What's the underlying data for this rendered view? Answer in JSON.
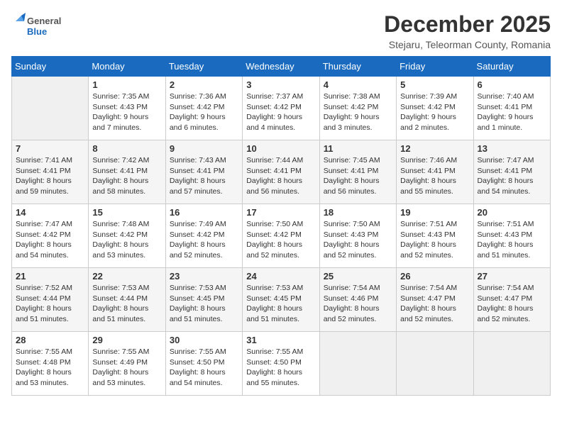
{
  "logo": {
    "general": "General",
    "blue": "Blue"
  },
  "title": {
    "month_year": "December 2025",
    "location": "Stejaru, Teleorman County, Romania"
  },
  "headers": [
    "Sunday",
    "Monday",
    "Tuesday",
    "Wednesday",
    "Thursday",
    "Friday",
    "Saturday"
  ],
  "weeks": [
    [
      {
        "day": "",
        "empty": true
      },
      {
        "day": "1",
        "sunrise": "Sunrise: 7:35 AM",
        "sunset": "Sunset: 4:43 PM",
        "daylight": "Daylight: 9 hours and 7 minutes."
      },
      {
        "day": "2",
        "sunrise": "Sunrise: 7:36 AM",
        "sunset": "Sunset: 4:42 PM",
        "daylight": "Daylight: 9 hours and 6 minutes."
      },
      {
        "day": "3",
        "sunrise": "Sunrise: 7:37 AM",
        "sunset": "Sunset: 4:42 PM",
        "daylight": "Daylight: 9 hours and 4 minutes."
      },
      {
        "day": "4",
        "sunrise": "Sunrise: 7:38 AM",
        "sunset": "Sunset: 4:42 PM",
        "daylight": "Daylight: 9 hours and 3 minutes."
      },
      {
        "day": "5",
        "sunrise": "Sunrise: 7:39 AM",
        "sunset": "Sunset: 4:42 PM",
        "daylight": "Daylight: 9 hours and 2 minutes."
      },
      {
        "day": "6",
        "sunrise": "Sunrise: 7:40 AM",
        "sunset": "Sunset: 4:41 PM",
        "daylight": "Daylight: 9 hours and 1 minute."
      }
    ],
    [
      {
        "day": "7",
        "sunrise": "Sunrise: 7:41 AM",
        "sunset": "Sunset: 4:41 PM",
        "daylight": "Daylight: 8 hours and 59 minutes."
      },
      {
        "day": "8",
        "sunrise": "Sunrise: 7:42 AM",
        "sunset": "Sunset: 4:41 PM",
        "daylight": "Daylight: 8 hours and 58 minutes."
      },
      {
        "day": "9",
        "sunrise": "Sunrise: 7:43 AM",
        "sunset": "Sunset: 4:41 PM",
        "daylight": "Daylight: 8 hours and 57 minutes."
      },
      {
        "day": "10",
        "sunrise": "Sunrise: 7:44 AM",
        "sunset": "Sunset: 4:41 PM",
        "daylight": "Daylight: 8 hours and 56 minutes."
      },
      {
        "day": "11",
        "sunrise": "Sunrise: 7:45 AM",
        "sunset": "Sunset: 4:41 PM",
        "daylight": "Daylight: 8 hours and 56 minutes."
      },
      {
        "day": "12",
        "sunrise": "Sunrise: 7:46 AM",
        "sunset": "Sunset: 4:41 PM",
        "daylight": "Daylight: 8 hours and 55 minutes."
      },
      {
        "day": "13",
        "sunrise": "Sunrise: 7:47 AM",
        "sunset": "Sunset: 4:41 PM",
        "daylight": "Daylight: 8 hours and 54 minutes."
      }
    ],
    [
      {
        "day": "14",
        "sunrise": "Sunrise: 7:47 AM",
        "sunset": "Sunset: 4:42 PM",
        "daylight": "Daylight: 8 hours and 54 minutes."
      },
      {
        "day": "15",
        "sunrise": "Sunrise: 7:48 AM",
        "sunset": "Sunset: 4:42 PM",
        "daylight": "Daylight: 8 hours and 53 minutes."
      },
      {
        "day": "16",
        "sunrise": "Sunrise: 7:49 AM",
        "sunset": "Sunset: 4:42 PM",
        "daylight": "Daylight: 8 hours and 52 minutes."
      },
      {
        "day": "17",
        "sunrise": "Sunrise: 7:50 AM",
        "sunset": "Sunset: 4:42 PM",
        "daylight": "Daylight: 8 hours and 52 minutes."
      },
      {
        "day": "18",
        "sunrise": "Sunrise: 7:50 AM",
        "sunset": "Sunset: 4:43 PM",
        "daylight": "Daylight: 8 hours and 52 minutes."
      },
      {
        "day": "19",
        "sunrise": "Sunrise: 7:51 AM",
        "sunset": "Sunset: 4:43 PM",
        "daylight": "Daylight: 8 hours and 52 minutes."
      },
      {
        "day": "20",
        "sunrise": "Sunrise: 7:51 AM",
        "sunset": "Sunset: 4:43 PM",
        "daylight": "Daylight: 8 hours and 51 minutes."
      }
    ],
    [
      {
        "day": "21",
        "sunrise": "Sunrise: 7:52 AM",
        "sunset": "Sunset: 4:44 PM",
        "daylight": "Daylight: 8 hours and 51 minutes."
      },
      {
        "day": "22",
        "sunrise": "Sunrise: 7:53 AM",
        "sunset": "Sunset: 4:44 PM",
        "daylight": "Daylight: 8 hours and 51 minutes."
      },
      {
        "day": "23",
        "sunrise": "Sunrise: 7:53 AM",
        "sunset": "Sunset: 4:45 PM",
        "daylight": "Daylight: 8 hours and 51 minutes."
      },
      {
        "day": "24",
        "sunrise": "Sunrise: 7:53 AM",
        "sunset": "Sunset: 4:45 PM",
        "daylight": "Daylight: 8 hours and 51 minutes."
      },
      {
        "day": "25",
        "sunrise": "Sunrise: 7:54 AM",
        "sunset": "Sunset: 4:46 PM",
        "daylight": "Daylight: 8 hours and 52 minutes."
      },
      {
        "day": "26",
        "sunrise": "Sunrise: 7:54 AM",
        "sunset": "Sunset: 4:47 PM",
        "daylight": "Daylight: 8 hours and 52 minutes."
      },
      {
        "day": "27",
        "sunrise": "Sunrise: 7:54 AM",
        "sunset": "Sunset: 4:47 PM",
        "daylight": "Daylight: 8 hours and 52 minutes."
      }
    ],
    [
      {
        "day": "28",
        "sunrise": "Sunrise: 7:55 AM",
        "sunset": "Sunset: 4:48 PM",
        "daylight": "Daylight: 8 hours and 53 minutes."
      },
      {
        "day": "29",
        "sunrise": "Sunrise: 7:55 AM",
        "sunset": "Sunset: 4:49 PM",
        "daylight": "Daylight: 8 hours and 53 minutes."
      },
      {
        "day": "30",
        "sunrise": "Sunrise: 7:55 AM",
        "sunset": "Sunset: 4:50 PM",
        "daylight": "Daylight: 8 hours and 54 minutes."
      },
      {
        "day": "31",
        "sunrise": "Sunrise: 7:55 AM",
        "sunset": "Sunset: 4:50 PM",
        "daylight": "Daylight: 8 hours and 55 minutes."
      },
      {
        "day": "",
        "empty": true
      },
      {
        "day": "",
        "empty": true
      },
      {
        "day": "",
        "empty": true
      }
    ]
  ]
}
